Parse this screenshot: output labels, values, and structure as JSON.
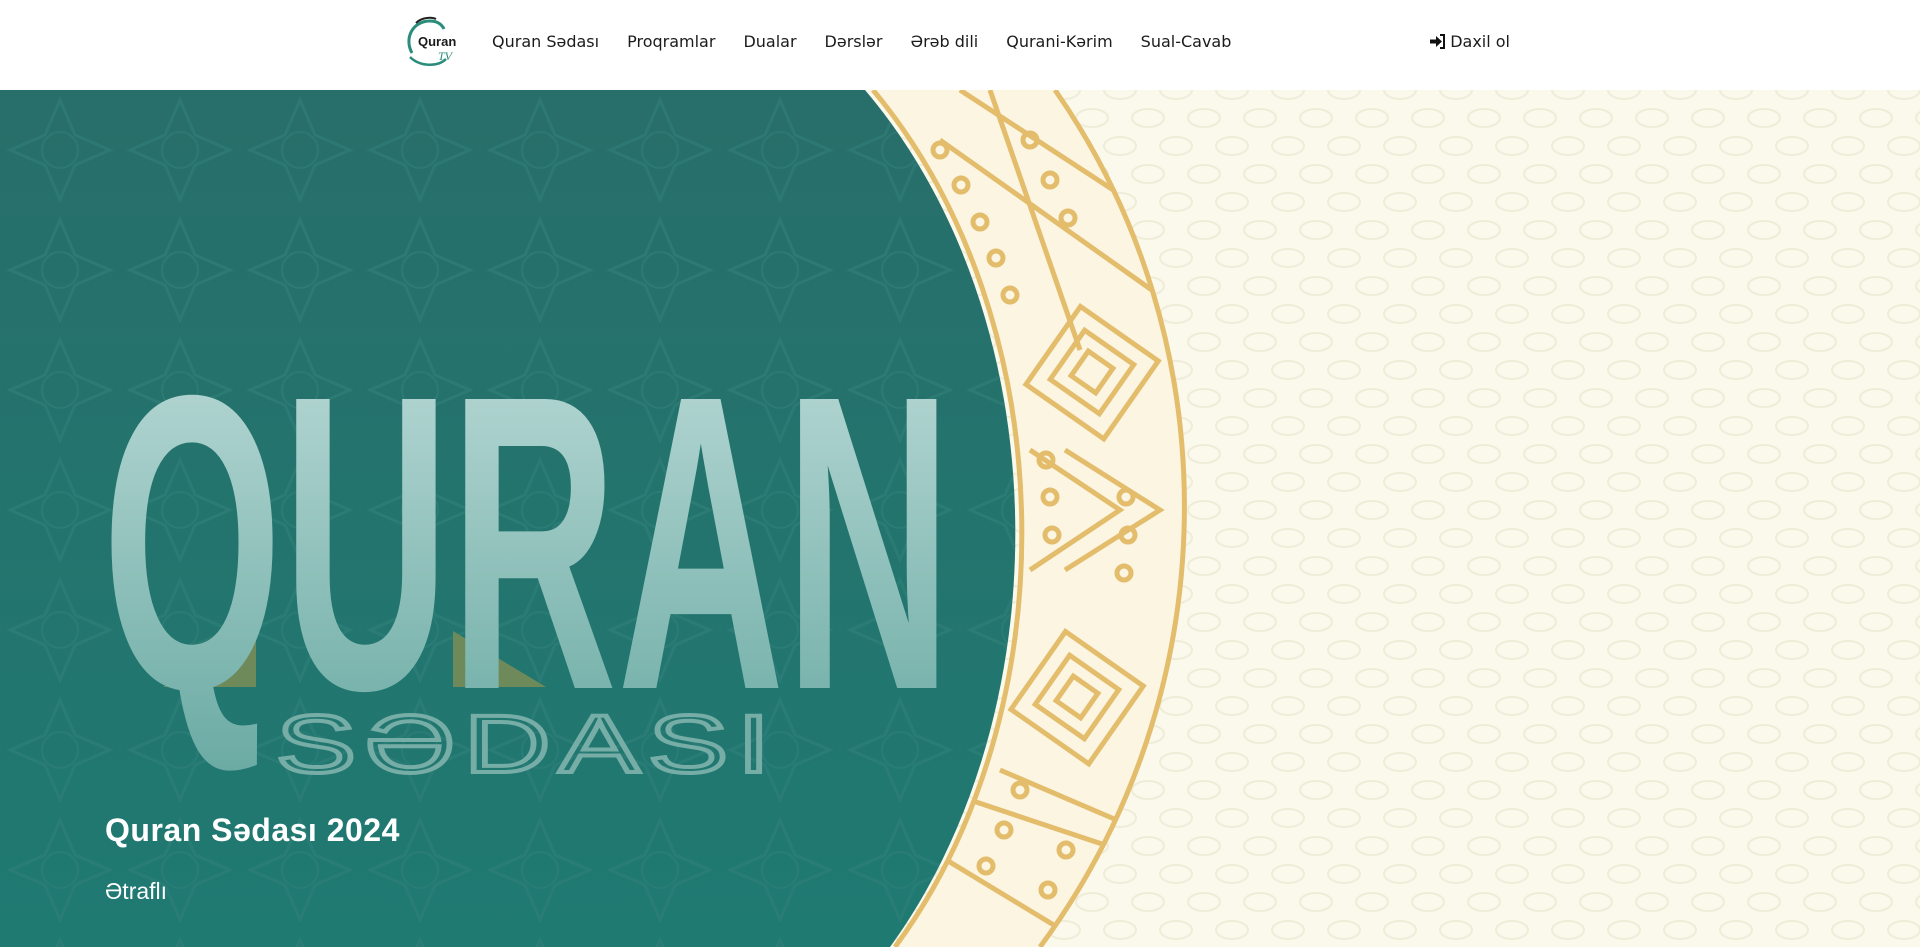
{
  "logo": {
    "line1": "Quran",
    "line2": "TV"
  },
  "nav": {
    "items": [
      {
        "label": "Quran Sədası"
      },
      {
        "label": "Proqramlar"
      },
      {
        "label": "Dualar"
      },
      {
        "label": "Dərslər"
      },
      {
        "label": "Ərəb dili"
      },
      {
        "label": "Qurani-Kərim"
      },
      {
        "label": "Sual-Cavab"
      }
    ],
    "login_label": "Daxil ol"
  },
  "hero": {
    "art_text_big": "QURAN",
    "art_text_small": "SƏDASI",
    "title": "Quran Sədası 2024",
    "more_label": "Ətraflı"
  },
  "colors": {
    "teal": "#2a736e",
    "teal_light": "#b9d9d6",
    "gold": "#e3bd6c",
    "cream": "#fbf9ec"
  }
}
